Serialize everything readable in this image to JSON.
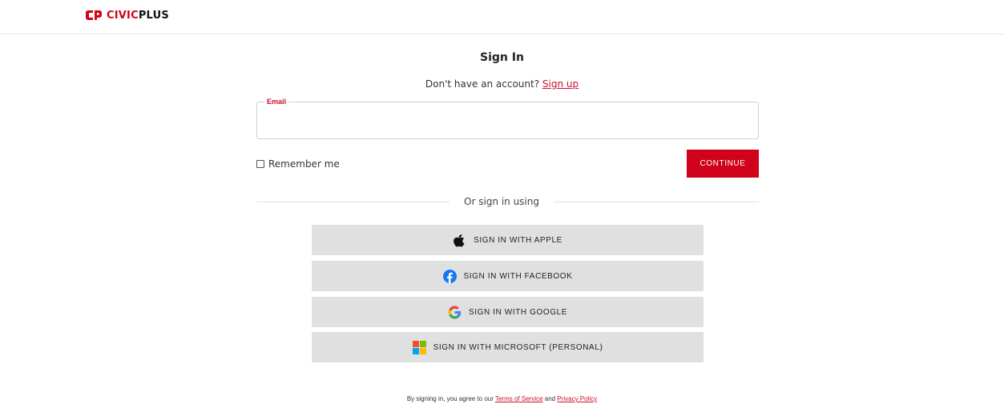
{
  "header": {
    "logo_civic": "CIVIC",
    "logo_plus": "PLUS",
    "brand_color": "#d0021b"
  },
  "signin": {
    "title": "Sign In",
    "no_account_text": "Don't have an account? ",
    "signup_link": "Sign up",
    "email_label": "Email",
    "email_value": "",
    "remember_label": "Remember me",
    "remember_checked": false,
    "continue_label": "CONTINUE",
    "divider_text": "Or sign in using"
  },
  "social": {
    "apple": {
      "label": "SIGN IN WITH APPLE",
      "icon": "apple-icon"
    },
    "facebook": {
      "label": "SIGN IN WITH FACEBOOK",
      "icon": "facebook-icon"
    },
    "google": {
      "label": "SIGN IN WITH GOOGLE",
      "icon": "google-icon"
    },
    "microsoft": {
      "label": "SIGN IN WITH MICROSOFT (PERSONAL)",
      "icon": "microsoft-icon"
    }
  },
  "footer": {
    "prefix": "By signing in, you agree to our ",
    "terms_link": "Terms of Service",
    "and": " and ",
    "privacy_link": "Privacy Policy"
  }
}
